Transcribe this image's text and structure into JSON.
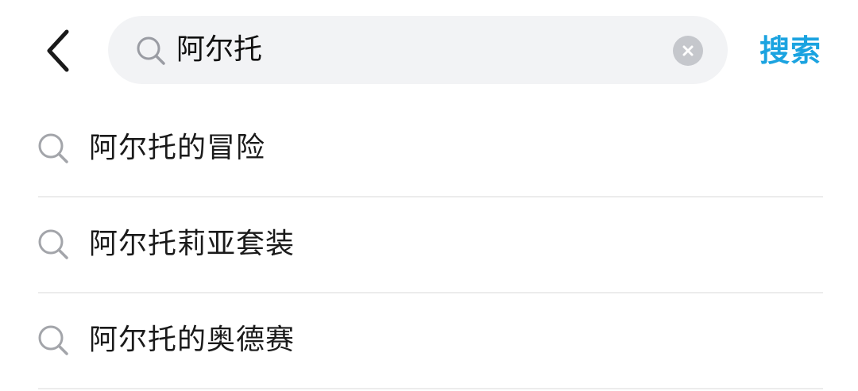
{
  "header": {
    "back_icon": "chevron-left-icon",
    "search": {
      "icon": "search-icon",
      "value": "阿尔托",
      "clear_icon": "clear-icon"
    },
    "search_button_label": "搜索",
    "accent_color": "#1ba3e0"
  },
  "suggestions": [
    {
      "icon": "search-icon",
      "label": "阿尔托的冒险"
    },
    {
      "icon": "search-icon",
      "label": "阿尔托莉亚套装"
    },
    {
      "icon": "search-icon",
      "label": "阿尔托的奥德赛"
    }
  ]
}
